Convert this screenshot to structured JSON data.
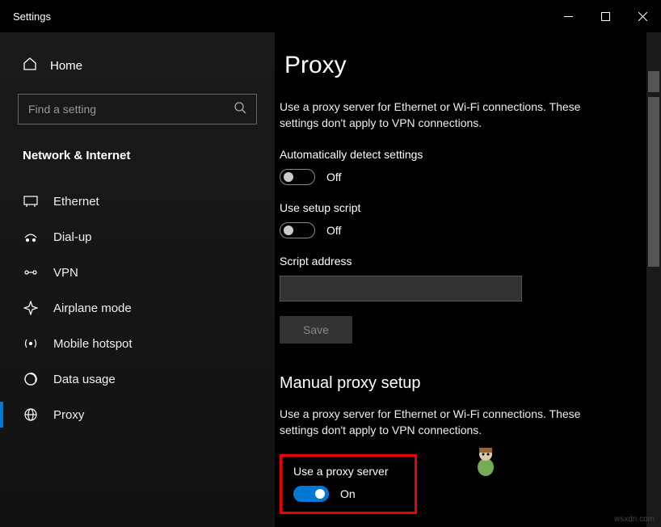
{
  "window": {
    "title": "Settings"
  },
  "sidebar": {
    "home": "Home",
    "search_placeholder": "Find a setting",
    "section": "Network & Internet",
    "items": [
      {
        "label": "Ethernet"
      },
      {
        "label": "Dial-up"
      },
      {
        "label": "VPN"
      },
      {
        "label": "Airplane mode"
      },
      {
        "label": "Mobile hotspot"
      },
      {
        "label": "Data usage"
      },
      {
        "label": "Proxy"
      }
    ]
  },
  "main": {
    "heading": "Proxy",
    "desc1": "Use a proxy server for Ethernet or Wi-Fi connections. These settings don't apply to VPN connections.",
    "auto_detect_label": "Automatically detect settings",
    "auto_detect_value": "Off",
    "setup_script_label": "Use setup script",
    "setup_script_value": "Off",
    "script_address_label": "Script address",
    "save_label": "Save",
    "manual_heading": "Manual proxy setup",
    "desc2": "Use a proxy server for Ethernet or Wi-Fi connections. These settings don't apply to VPN connections.",
    "use_proxy_label": "Use a proxy server",
    "use_proxy_value": "On"
  },
  "watermark": "wsxdn.com"
}
